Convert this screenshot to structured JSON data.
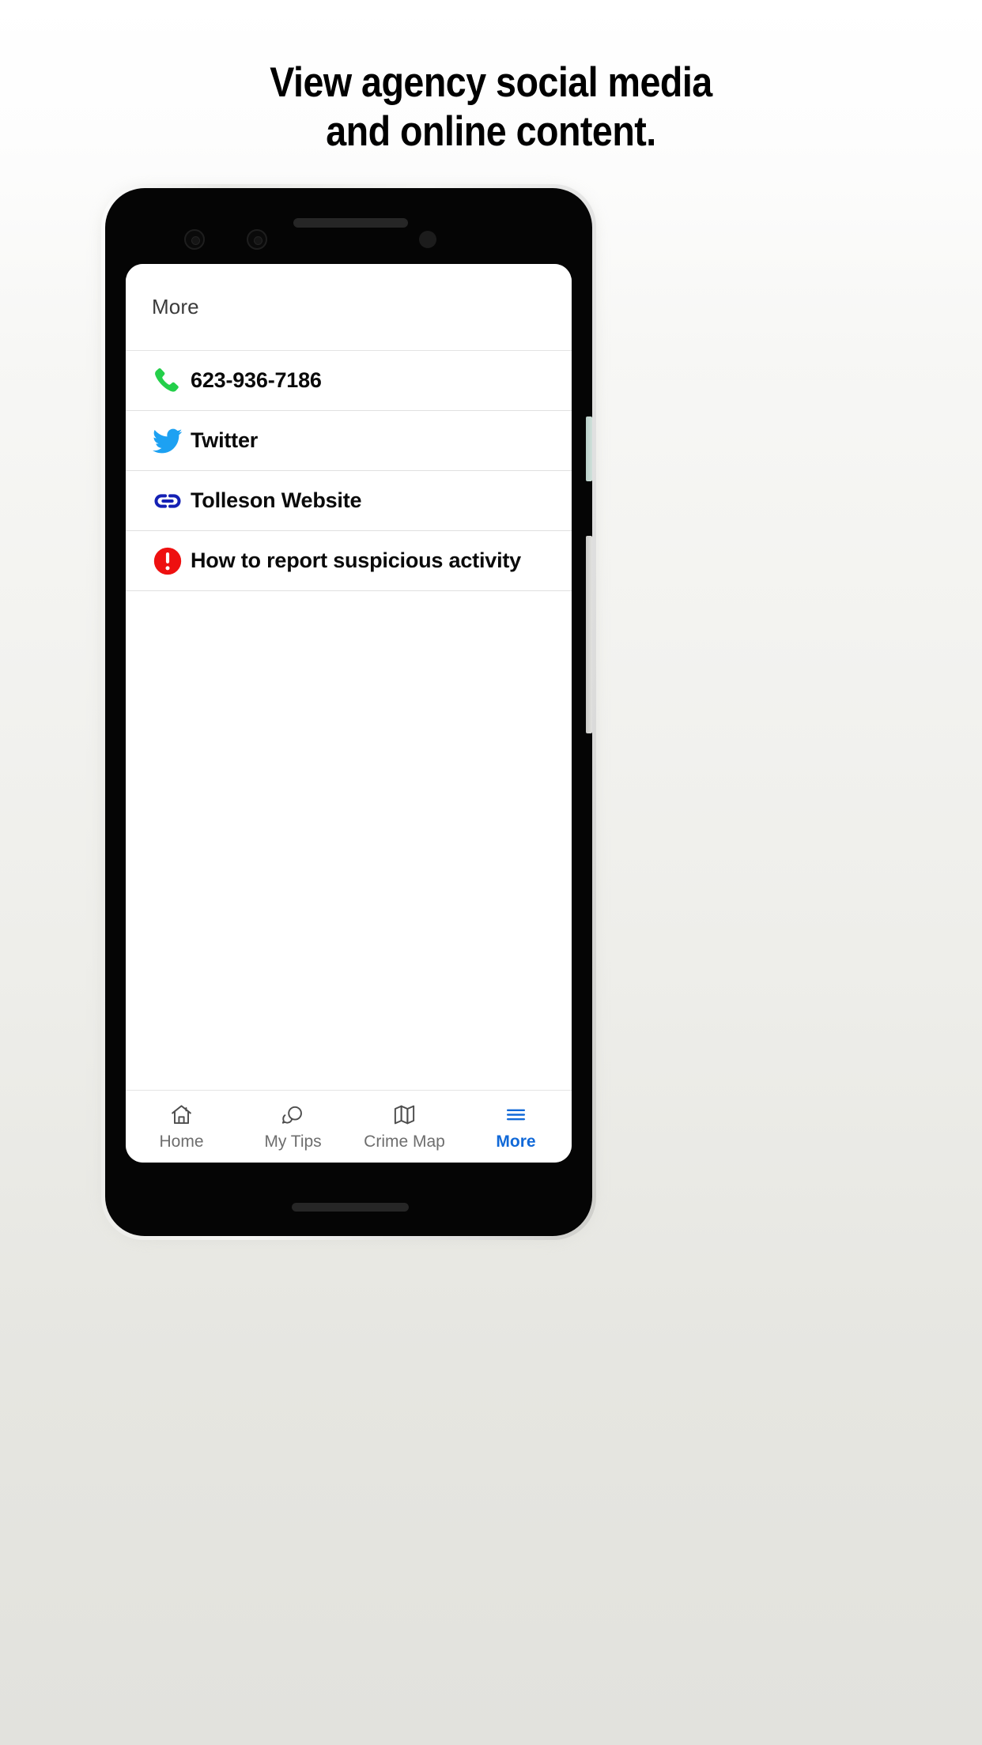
{
  "headline": {
    "line1": "View agency social media",
    "line2": "and online content."
  },
  "app": {
    "header": {
      "title": "More"
    },
    "list": {
      "items": [
        {
          "label": "623-936-7186",
          "icon": "phone-icon",
          "color": "#24cf4a"
        },
        {
          "label": "Twitter",
          "icon": "twitter-bird-icon",
          "color": "#1da1f2"
        },
        {
          "label": "Tolleson Website",
          "icon": "link-icon",
          "color": "#1420b4"
        },
        {
          "label": "How to report suspicious activity",
          "icon": "alert-circle-icon",
          "color": "#ee1010"
        }
      ]
    },
    "tabbar": {
      "items": [
        {
          "label": "Home",
          "icon": "home-icon",
          "active": false
        },
        {
          "label": "My Tips",
          "icon": "chat-bubbles-icon",
          "active": false
        },
        {
          "label": "Crime Map",
          "icon": "map-icon",
          "active": false
        },
        {
          "label": "More",
          "icon": "hamburger-menu-icon",
          "active": true
        }
      ]
    }
  },
  "colors": {
    "accent": "#1169d8",
    "inactive_tab": "#6e6e6e",
    "page_bg": "#efefec"
  }
}
